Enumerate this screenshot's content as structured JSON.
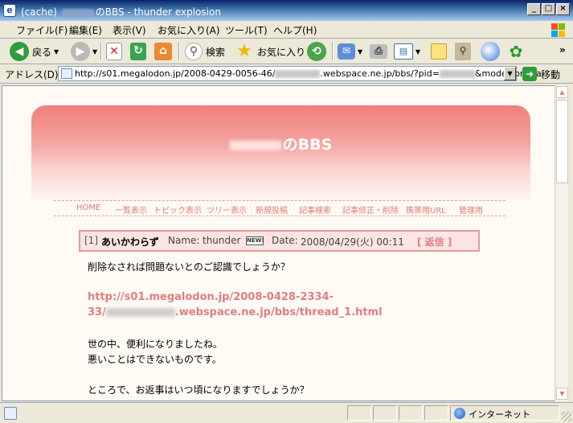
{
  "window": {
    "title_prefix": "(cache)",
    "title_suffix": "のBBS - thunder explosion",
    "minimize": "_",
    "maximize": "□",
    "close": "×"
  },
  "menu": [
    "ファイル(F)",
    "編集(E)",
    "表示(V)",
    "お気に入り(A)",
    "ツール(T)",
    "ヘルプ(H)"
  ],
  "toolbar": {
    "back_label": "戻る",
    "search_label": "検索",
    "favorites_label": "お気に入り",
    "more": "»"
  },
  "address": {
    "label": "アドレス(D)",
    "url_start": "http://s01.megalodon.jp/2008-0429-0056-46/",
    "url_end": ".webspace.ne.jp/bbs/?pid=",
    "url_tail": "&mode=pr&pa",
    "go_label": "移動"
  },
  "bbs": {
    "title_suffix": "のBBS",
    "nav": [
      "HOME",
      "一覧表示",
      "トピック表示",
      "ツリー表示",
      "新規投稿",
      "記事検索",
      "記事修正・削除",
      "携帯用URL",
      "管理用"
    ]
  },
  "post": {
    "number": "[1]",
    "subject": "あいかわらず",
    "name_label": "Name:",
    "name": "thunder",
    "new_badge": "NEW!",
    "date_label": "Date:",
    "date": "2008/04/29(火) 00:11",
    "reply": "[ 返信 ]",
    "line1": "削除なされば問題ないとのご認識でしょうか？",
    "link_line1": "http://s01.megalodon.jp/2008-0428-2334-",
    "link_line2_start": "33/",
    "link_line2_end": ".webspace.ne.jp/bbs/thread_1.html",
    "line2": "世の中、便利になりましたね。",
    "line3": "悪いことはできないものです。",
    "line4": "ところで、お返事はいつ頃になりますでしょうか？"
  },
  "status": {
    "zone": "インターネット"
  }
}
